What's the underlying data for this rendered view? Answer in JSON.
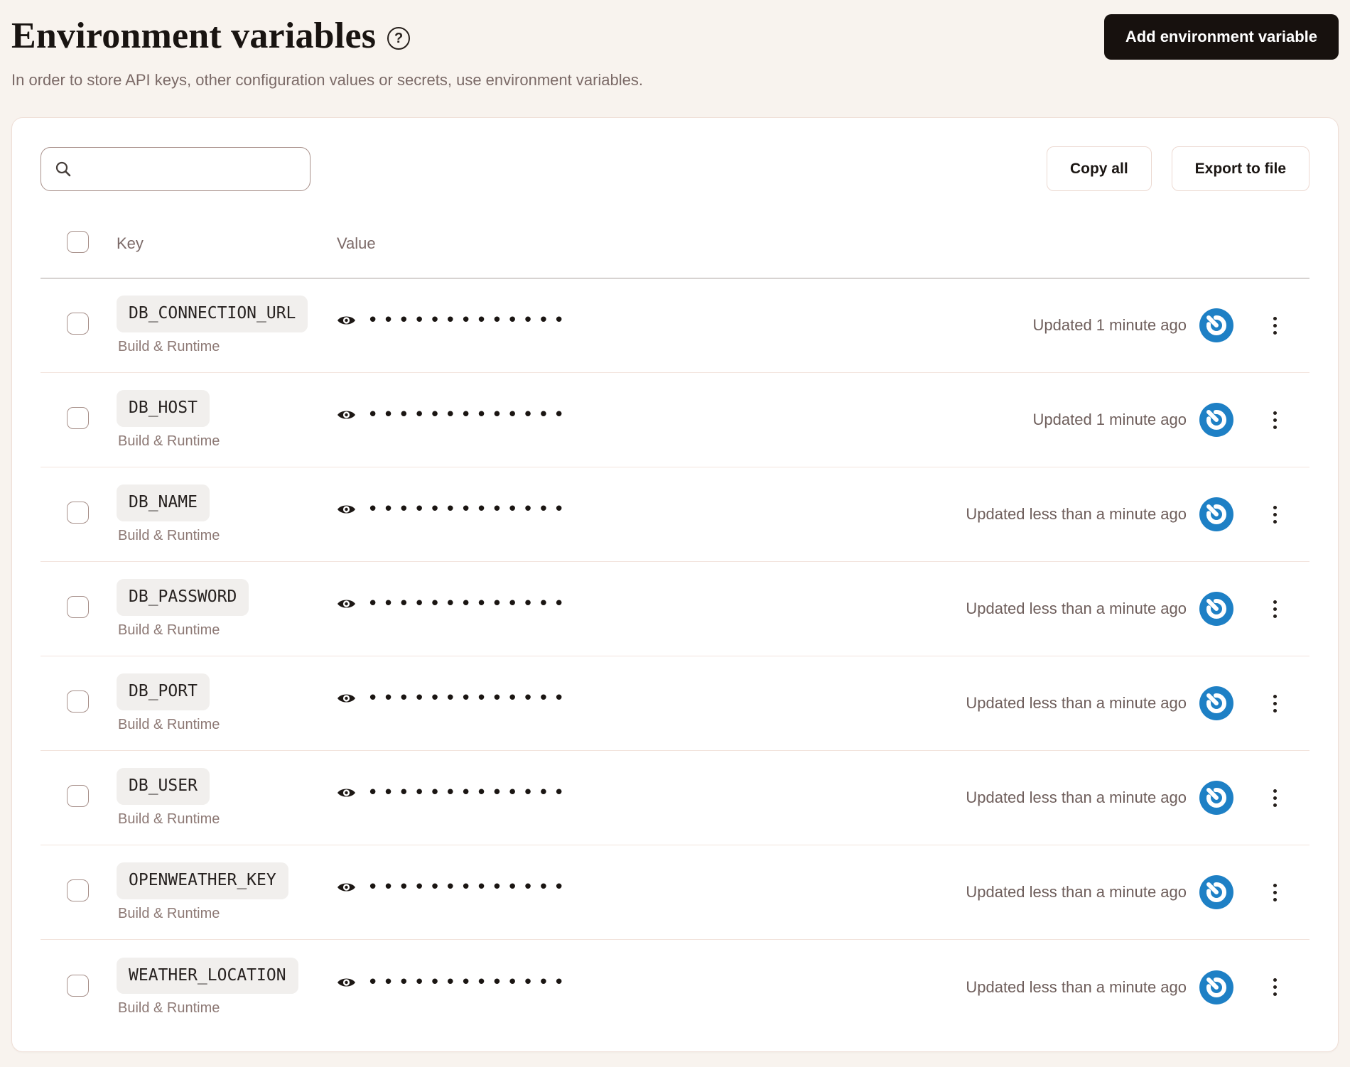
{
  "header": {
    "title": "Environment variables",
    "help_icon": "?",
    "subtitle": "In order to store API keys, other configuration values or secrets, use environment variables.",
    "add_button_label": "Add environment variable"
  },
  "toolbar": {
    "search_value": "",
    "copy_all_label": "Copy all",
    "export_label": "Export to file"
  },
  "table": {
    "key_header": "Key",
    "value_header": "Value",
    "rows": [
      {
        "key": "DB_CONNECTION_URL",
        "scope": "Build & Runtime",
        "masked_value": "•••••••••••••",
        "updated": "Updated 1 minute ago"
      },
      {
        "key": "DB_HOST",
        "scope": "Build & Runtime",
        "masked_value": "•••••••••••••",
        "updated": "Updated 1 minute ago"
      },
      {
        "key": "DB_NAME",
        "scope": "Build & Runtime",
        "masked_value": "•••••••••••••",
        "updated": "Updated less than a minute ago"
      },
      {
        "key": "DB_PASSWORD",
        "scope": "Build & Runtime",
        "masked_value": "•••••••••••••",
        "updated": "Updated less than a minute ago"
      },
      {
        "key": "DB_PORT",
        "scope": "Build & Runtime",
        "masked_value": "•••••••••••••",
        "updated": "Updated less than a minute ago"
      },
      {
        "key": "DB_USER",
        "scope": "Build & Runtime",
        "masked_value": "•••••••••••••",
        "updated": "Updated less than a minute ago"
      },
      {
        "key": "OPENWEATHER_KEY",
        "scope": "Build & Runtime",
        "masked_value": "•••••••••••••",
        "updated": "Updated less than a minute ago"
      },
      {
        "key": "WEATHER_LOCATION",
        "scope": "Build & Runtime",
        "masked_value": "•••••••••••••",
        "updated": "Updated less than a minute ago"
      }
    ]
  },
  "icons": {
    "help": "question-mark-circle",
    "search": "magnifier",
    "eye": "eye-filled",
    "sync": "blue-power-spiral",
    "kebab": "vertical-ellipsis"
  },
  "colors": {
    "page_bg": "#f8f3ee",
    "card_bg": "#ffffff",
    "primary_button_bg": "#17110e",
    "accent_blue": "#1e80c5",
    "muted_text": "#7b6a67",
    "chip_bg": "#f1efed",
    "row_divider": "#f2e3dc",
    "header_divider": "#a89f9b"
  }
}
